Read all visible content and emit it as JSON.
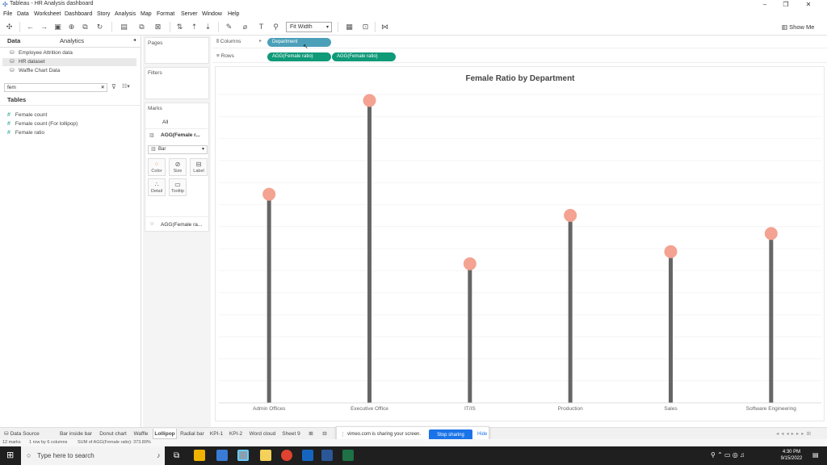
{
  "window": {
    "title": "Tableau - HR Analysis dashboard",
    "controls": [
      "–",
      "❐",
      "✕"
    ]
  },
  "menu": [
    "File",
    "Data",
    "Worksheet",
    "Dashboard",
    "Story",
    "Analysis",
    "Map",
    "Format",
    "Server",
    "Window",
    "Help"
  ],
  "toolbar": {
    "fit_value": "Fit Width",
    "show_me": "Show Me"
  },
  "data_pane": {
    "tabs": [
      "Data",
      "Analytics"
    ],
    "datasources": [
      "Employee Attrition data",
      "HR dataset",
      "Waffle Chart Data"
    ],
    "selected_datasource": "HR dataset",
    "search_value": "fem",
    "tables_header": "Tables",
    "fields": [
      "Female count",
      "Female count (For lollipop)",
      "Female ratio"
    ]
  },
  "cards": {
    "pages": "Pages",
    "filters": "Filters",
    "marks": "Marks",
    "marks_all": "All",
    "marks_agg1": "AGG(Female r...",
    "mark_type": "Bar",
    "mark_buttons": [
      "Color",
      "Size",
      "Label",
      "Detail",
      "Tooltip"
    ],
    "marks_agg2": "AGG(Female ra..."
  },
  "shelves": {
    "columns_label": "Columns",
    "rows_label": "Rows",
    "columns_pill": "Department",
    "rows_pills": [
      "AGG(Female ratio)",
      "AGG(Female ratio)"
    ]
  },
  "chart_data": {
    "type": "lollipop",
    "title": "Female Ratio by Department",
    "categories": [
      "Admin Offices",
      "Executive Office",
      "IT/IS",
      "Production",
      "Sales",
      "Software Engineering"
    ],
    "values": [
      0.69,
      1.0,
      0.46,
      0.62,
      0.5,
      0.56
    ],
    "ylim": [
      0,
      1.02
    ],
    "stem_color": "#666666",
    "dot_color": "#f4a291",
    "grid": true
  },
  "sheet_tabs": [
    "Data Source",
    "Bar inside bar",
    "Donut chart",
    "Waffle",
    "Lollipop",
    "Radial bar",
    "KPI-1",
    "KPI-2",
    "Word cloud",
    "Sheet 9"
  ],
  "active_tab": "Lollipop",
  "status": {
    "marks": "12 marks",
    "rows_cols": "1 row by 6 columns",
    "sum": "SUM of AGG(Female ratio): 373.89%"
  },
  "share_bar": {
    "message": "vimeo.com is sharing your screen.",
    "stop": "Stop sharing",
    "hide": "Hide"
  },
  "taskbar": {
    "search_placeholder": "Type here to search",
    "time": "4:30 PM",
    "date": "9/15/2022"
  }
}
